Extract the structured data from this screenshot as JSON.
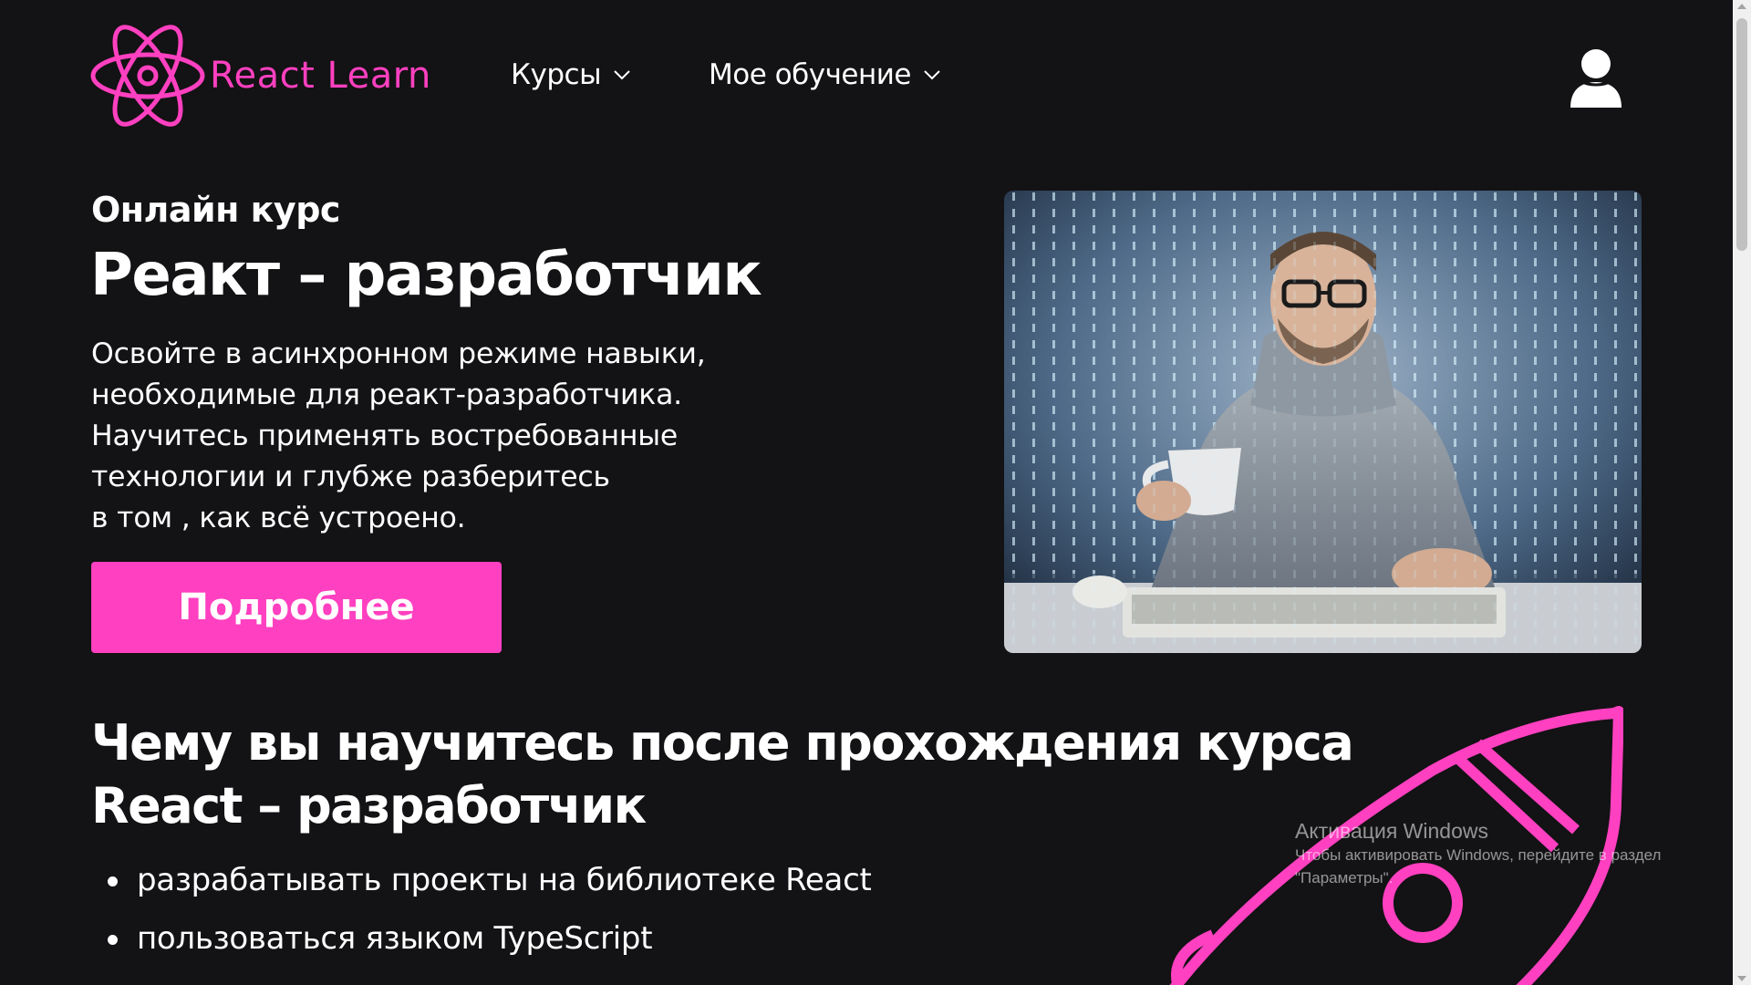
{
  "colors": {
    "accent": "#ff40c0",
    "background": "#131214",
    "text": "#ffffff"
  },
  "header": {
    "logo_text": "React Learn",
    "logo_icon": "atom-icon",
    "nav": [
      {
        "label": "Курсы",
        "icon": "chevron-down-icon"
      },
      {
        "label": "Мое обучение",
        "icon": "chevron-down-icon"
      }
    ],
    "user_icon": "user-icon"
  },
  "hero": {
    "subtitle": "Онлайн курс",
    "title": "Реакт – разработчик",
    "description": [
      "Освойте в асинхронном режиме навыки,",
      "необходимые для реакт-разработчика.",
      "Научитесь применять востребованные",
      "технологии и глубже разберитесь",
      "в том , как всё устроено."
    ],
    "cta_label": "Подробнее",
    "image": "developer-with-coffee-photo"
  },
  "learn": {
    "title_lines": [
      "Чему вы научитесь после прохождения курса",
      "React – разработчик"
    ],
    "items": [
      "разрабатывать проекты на библиотеке React",
      "пользоваться языком TypeScript"
    ],
    "decor_icon": "rocket-icon"
  },
  "watermark": {
    "title": "Активация Windows",
    "line1": "Чтобы активировать Windows, перейдите в раздел",
    "line2": "\"Параметры\"."
  }
}
